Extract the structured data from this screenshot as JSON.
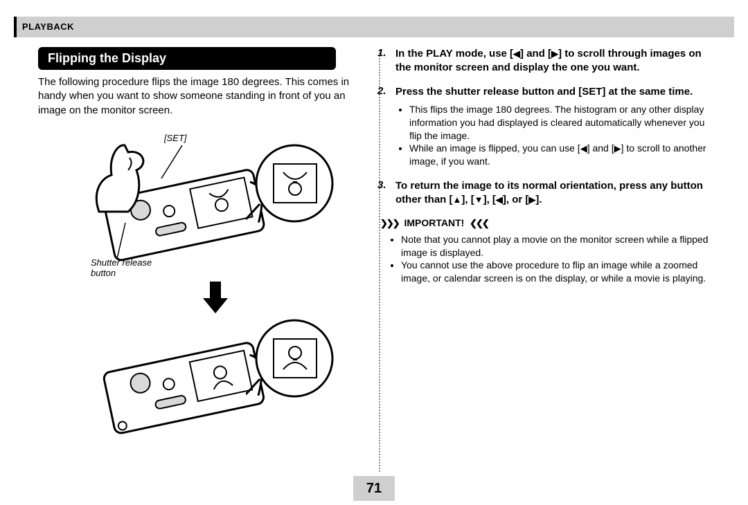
{
  "header": {
    "section": "PLAYBACK"
  },
  "heading": "Flipping the Display",
  "intro": "The following procedure flips the image 180 degrees. This comes in handy when you want to show someone standing in front of you an image on the monitor screen.",
  "callouts": {
    "set": "[SET]",
    "shutter": "Shutter release button"
  },
  "glyphs": {
    "left": "◀",
    "right": "▶",
    "up": "▲",
    "down": "▼"
  },
  "steps": [
    {
      "num": "1.",
      "head_pre": "In the PLAY mode, use [",
      "head_mid": "] and [",
      "head_post": "] to scroll through images on the monitor screen and display the one you want."
    },
    {
      "num": "2.",
      "head": "Press the shutter release button and [SET] at the same time.",
      "bullets": [
        {
          "text": "This flips the image 180 degrees. The histogram or any other display information you had displayed is cleared automatically whenever you flip the image."
        },
        {
          "pre": "While an image is flipped, you can use [",
          "mid": "] and [",
          "post": "] to scroll to another image, if you want."
        }
      ]
    },
    {
      "num": "3.",
      "head_pre": "To return the image to its normal orientation, press any button other than [",
      "sep": "], [",
      "head_post": "]."
    }
  ],
  "important": {
    "label": "IMPORTANT!",
    "bullets": [
      "Note that you cannot play a movie on the monitor screen while a flipped image is displayed.",
      "You cannot use the above procedure to flip an image while a zoomed image, or calendar screen is on the display, or while a movie is playing."
    ]
  },
  "page_number": "71"
}
